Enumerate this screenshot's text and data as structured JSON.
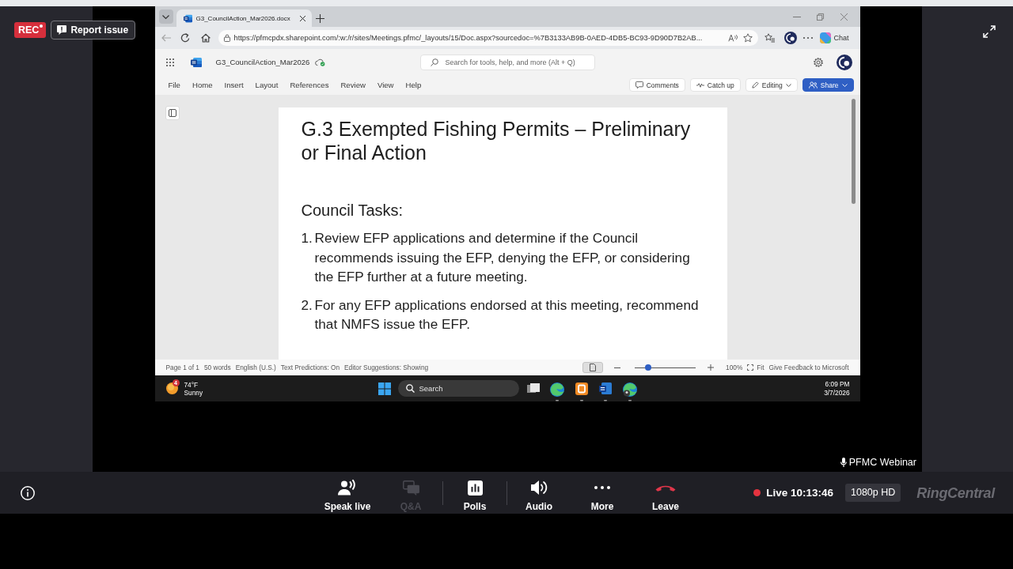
{
  "recording": {
    "badge": "REC",
    "report": "Report issue"
  },
  "browser": {
    "tabs": [
      {
        "title": "G3_CouncilAction_Mar2026.docx",
        "selected": true
      }
    ],
    "url": "https://pfmcpdx.sharepoint.com/:w:/r/sites/Meetings.pfmc/_layouts/15/Doc.aspx?sourcedoc=%7B3133AB9B-0AED-4DB5-BC93-9D90D7B2AB...",
    "chat": "Chat"
  },
  "word": {
    "doc_name": "G3_CouncilAction_Mar2026",
    "search": {
      "placeholder": "Search for tools, help, and more (Alt + Q)"
    },
    "menu": [
      "File",
      "Home",
      "Insert",
      "Layout",
      "References",
      "Review",
      "View",
      "Help"
    ],
    "actions": [
      {
        "label": "Comments",
        "kind": "comments"
      },
      {
        "label": "Catch up",
        "kind": "catchup"
      },
      {
        "label": "Editing",
        "kind": "editing"
      },
      {
        "label": "Share",
        "kind": "share"
      }
    ],
    "document": {
      "title": "G.3 Exempted Fishing Permits – Preliminary or Final Action",
      "heading": "Council Tasks:",
      "tasks": [
        {
          "marker": "1.",
          "text": "Review EFP applications and determine if the Council recommends issuing the EFP, denying the EFP, or considering the EFP further at a future meeting."
        },
        {
          "marker": "2.",
          "text": "For any EFP applications endorsed at this meeting, recommend that NMFS issue the EFP."
        }
      ]
    },
    "status": {
      "items": [
        "Page 1 of 1",
        "50 words",
        "English (U.S.)",
        "Text Predictions: On",
        "Editor Suggestions: Showing"
      ],
      "layout_view": {
        "selected": true
      },
      "zoom": {
        "level": 0.22,
        "reading": "100%"
      },
      "fit": "Fit",
      "feedback": "Give Feedback to Microsoft"
    }
  },
  "taskbar": {
    "weather": {
      "badge": "4",
      "temperature": "74°F",
      "condition": "Sunny"
    },
    "search": {
      "placeholder": "Search"
    },
    "time": "6:09 PM",
    "date": "3/7/2026"
  },
  "stage": {
    "presenter": "PFMC Webinar"
  },
  "controls": {
    "groups": [
      [
        {
          "label": "Speak live",
          "kind": "speak",
          "disabled": false
        },
        {
          "label": "Q&A",
          "kind": "qa",
          "disabled": true
        }
      ],
      [
        {
          "label": "Polls",
          "kind": "polls",
          "disabled": false
        }
      ],
      [
        {
          "label": "Audio",
          "kind": "audio",
          "disabled": false
        },
        {
          "label": "More",
          "kind": "more",
          "disabled": false
        },
        {
          "label": "Leave",
          "kind": "leave",
          "disabled": false
        }
      ]
    ],
    "live": "Live 10:13:46",
    "quality": "1080p HD",
    "brand": "RingCentral"
  }
}
